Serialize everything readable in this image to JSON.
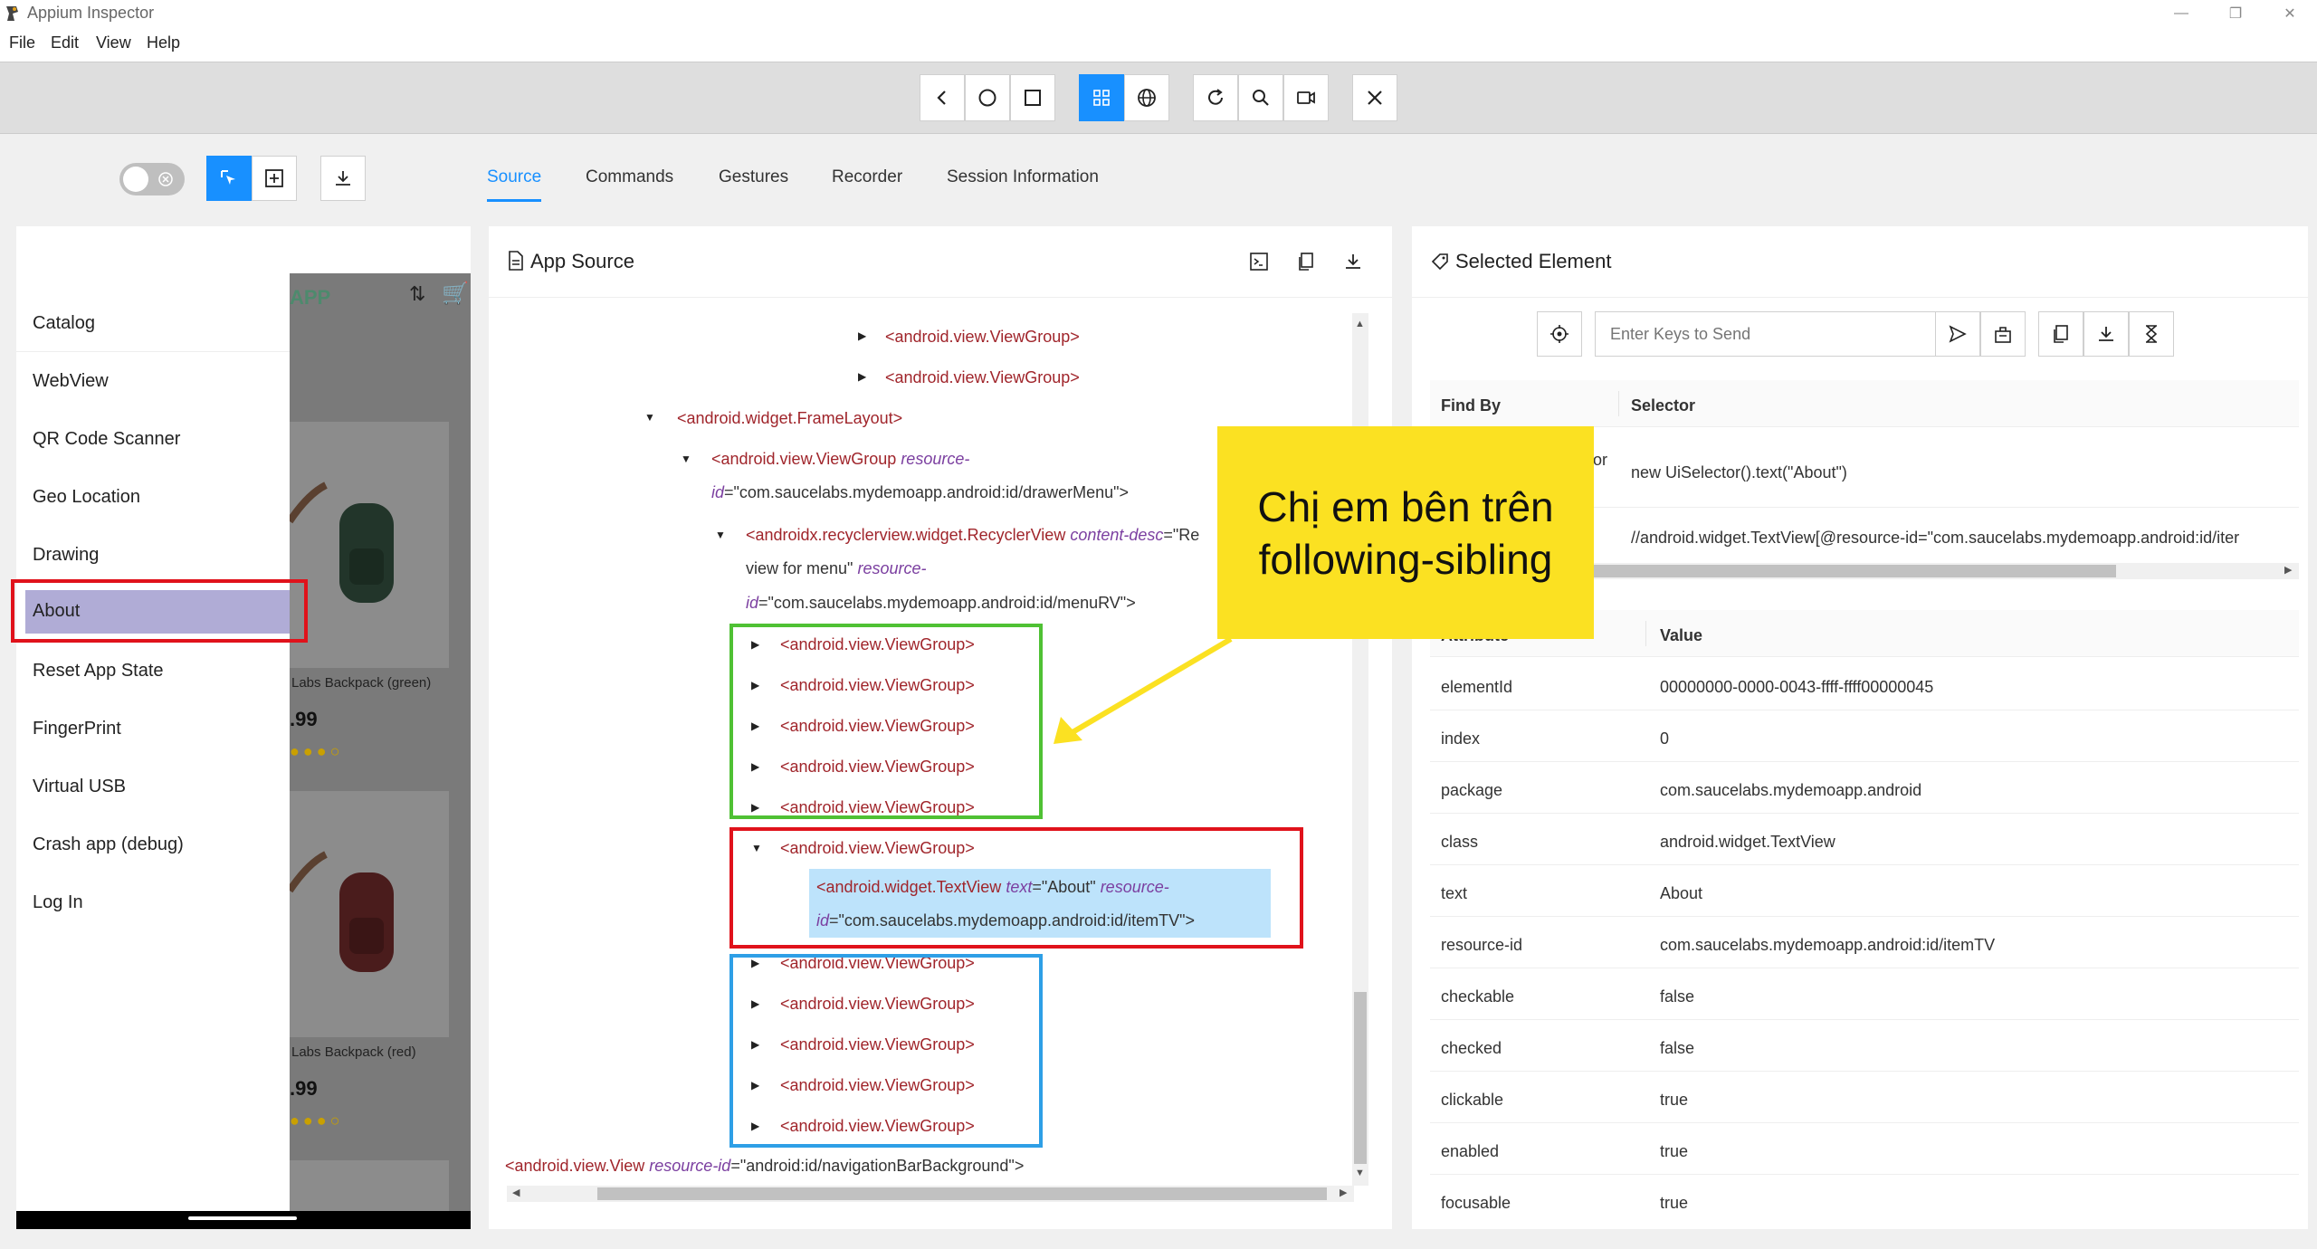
{
  "window": {
    "title": "Appium Inspector"
  },
  "menu": [
    "File",
    "Edit",
    "View",
    "Help"
  ],
  "tabs": [
    "Source",
    "Commands",
    "Gestures",
    "Recorder",
    "Session Information"
  ],
  "device": {
    "drawer_items": [
      "Catalog",
      "WebView",
      "QR Code Scanner",
      "Geo Location",
      "Drawing",
      "About",
      "Reset App State",
      "FingerPrint",
      "Virtual USB",
      "Crash app (debug)",
      "Log In"
    ],
    "selected_item": "About",
    "background": {
      "logo_fragment": "APP",
      "product1": "Labs Backpack (green)",
      "price1": ".99",
      "product2": "Labs Backpack (red)",
      "price2": ".99"
    }
  },
  "source": {
    "title": "App Source",
    "lines": [
      {
        "caret": "right",
        "tag": "<android.view.ViewGroup>"
      },
      {
        "caret": "right",
        "tag": "<android.view.ViewGroup>"
      },
      {
        "caret": "down",
        "tag": "<android.widget.FrameLayout>"
      },
      {
        "caret": "down",
        "tag_open": "<android.view.ViewGroup",
        "attr": "resource-",
        "cont": "id",
        "val": "\"com.saucelabs.mydemoapp.android:id/drawerMenu\">"
      },
      {
        "caret": "down",
        "tag_open": "<androidx.recyclerview.widget.RecyclerView",
        "attr": "content-desc",
        "val_part": "\"Re",
        "cont_val": "view for menu\"",
        "attr2": "resource-",
        "cont2": "id",
        "val2": "\"com.saucelabs.mydemoapp.android:id/menuRV\">"
      },
      {
        "caret": "right",
        "tag": "<android.view.ViewGroup>"
      },
      {
        "caret": "right",
        "tag": "<android.view.ViewGroup>"
      },
      {
        "caret": "right",
        "tag": "<android.view.ViewGroup>"
      },
      {
        "caret": "right",
        "tag": "<android.view.ViewGroup>"
      },
      {
        "caret": "right",
        "tag": "<android.view.ViewGroup>"
      },
      {
        "caret": "down",
        "tag": "<android.view.ViewGroup>"
      },
      {
        "tag_open": "<android.widget.TextView",
        "attr": "text",
        "val": "\"About\"",
        "attr2": "resource-",
        "cont2": "id",
        "val2": "\"com.saucelabs.mydemoapp.android:id/itemTV\">"
      },
      {
        "caret": "right",
        "tag": "<android.view.ViewGroup>"
      },
      {
        "caret": "right",
        "tag": "<android.view.ViewGroup>"
      },
      {
        "caret": "right",
        "tag": "<android.view.ViewGroup>"
      },
      {
        "caret": "right",
        "tag": "<android.view.ViewGroup>"
      },
      {
        "caret": "right",
        "tag": "<android.view.ViewGroup>"
      },
      {
        "tag_open": "<android.view.View",
        "attr": "resource-id",
        "val": "\"android:id/navigationBarBackground\">"
      }
    ]
  },
  "selected": {
    "title": "Selected Element",
    "keys_placeholder": "Enter Keys to Send",
    "find_by_header": "Find By",
    "selector_header": "Selector",
    "selectors": [
      {
        "find_by": "or",
        "selector": "new UiSelector().text(\"About\")"
      },
      {
        "find_by": "",
        "selector": "//android.widget.TextView[@resource-id=\"com.saucelabs.mydemoapp.android:id/iter"
      }
    ],
    "attribute_header": "Attribute",
    "value_header": "Value",
    "attributes": [
      {
        "name": "elementId",
        "value": "00000000-0000-0043-ffff-ffff00000045"
      },
      {
        "name": "index",
        "value": "0"
      },
      {
        "name": "package",
        "value": "com.saucelabs.mydemoapp.android"
      },
      {
        "name": "class",
        "value": "android.widget.TextView"
      },
      {
        "name": "text",
        "value": "About"
      },
      {
        "name": "resource-id",
        "value": "com.saucelabs.mydemoapp.android:id/itemTV"
      },
      {
        "name": "checkable",
        "value": "false"
      },
      {
        "name": "checked",
        "value": "false"
      },
      {
        "name": "clickable",
        "value": "true"
      },
      {
        "name": "enabled",
        "value": "true"
      },
      {
        "name": "focusable",
        "value": "true"
      }
    ]
  },
  "annotation": {
    "callout_line1": "Chị em bên trên",
    "callout_line2": "following-sibling",
    "colors": {
      "red": "#e0121b",
      "green": "#4fc134",
      "blue": "#2e9fe6",
      "yellow": "#fbe122",
      "accent": "#1890ff"
    }
  }
}
